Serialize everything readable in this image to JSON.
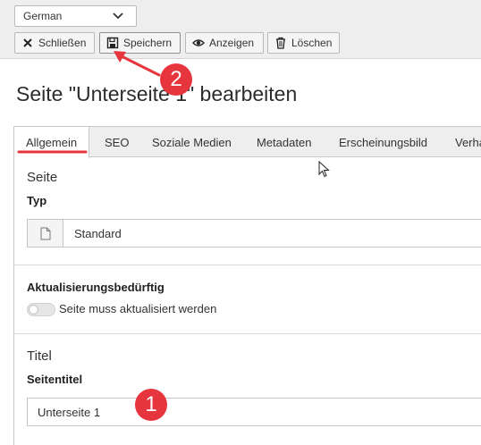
{
  "toolbar": {
    "language": "German",
    "close_label": "Schließen",
    "save_label": "Speichern",
    "view_label": "Anzeigen",
    "delete_label": "Löschen"
  },
  "page_title": "Seite \"Unterseite 1\" bearbeiten",
  "tabs": [
    {
      "label": "Allgemein",
      "active": true
    },
    {
      "label": "SEO"
    },
    {
      "label": "Soziale Medien"
    },
    {
      "label": "Metadaten"
    },
    {
      "label": "Erscheinungsbild"
    },
    {
      "label": "Verha"
    }
  ],
  "section_page": {
    "title": "Seite",
    "type_label": "Typ",
    "type_value": "Standard"
  },
  "update_needed": {
    "label": "Aktualisierungsbedürftig",
    "toggle_text": "Seite muss aktualisiert werden"
  },
  "section_title": {
    "title": "Titel",
    "page_title_label": "Seitentitel",
    "page_title_value": "Unterseite 1"
  },
  "annotations": {
    "step1": "1",
    "step2": "2",
    "color": "#e6353c"
  }
}
